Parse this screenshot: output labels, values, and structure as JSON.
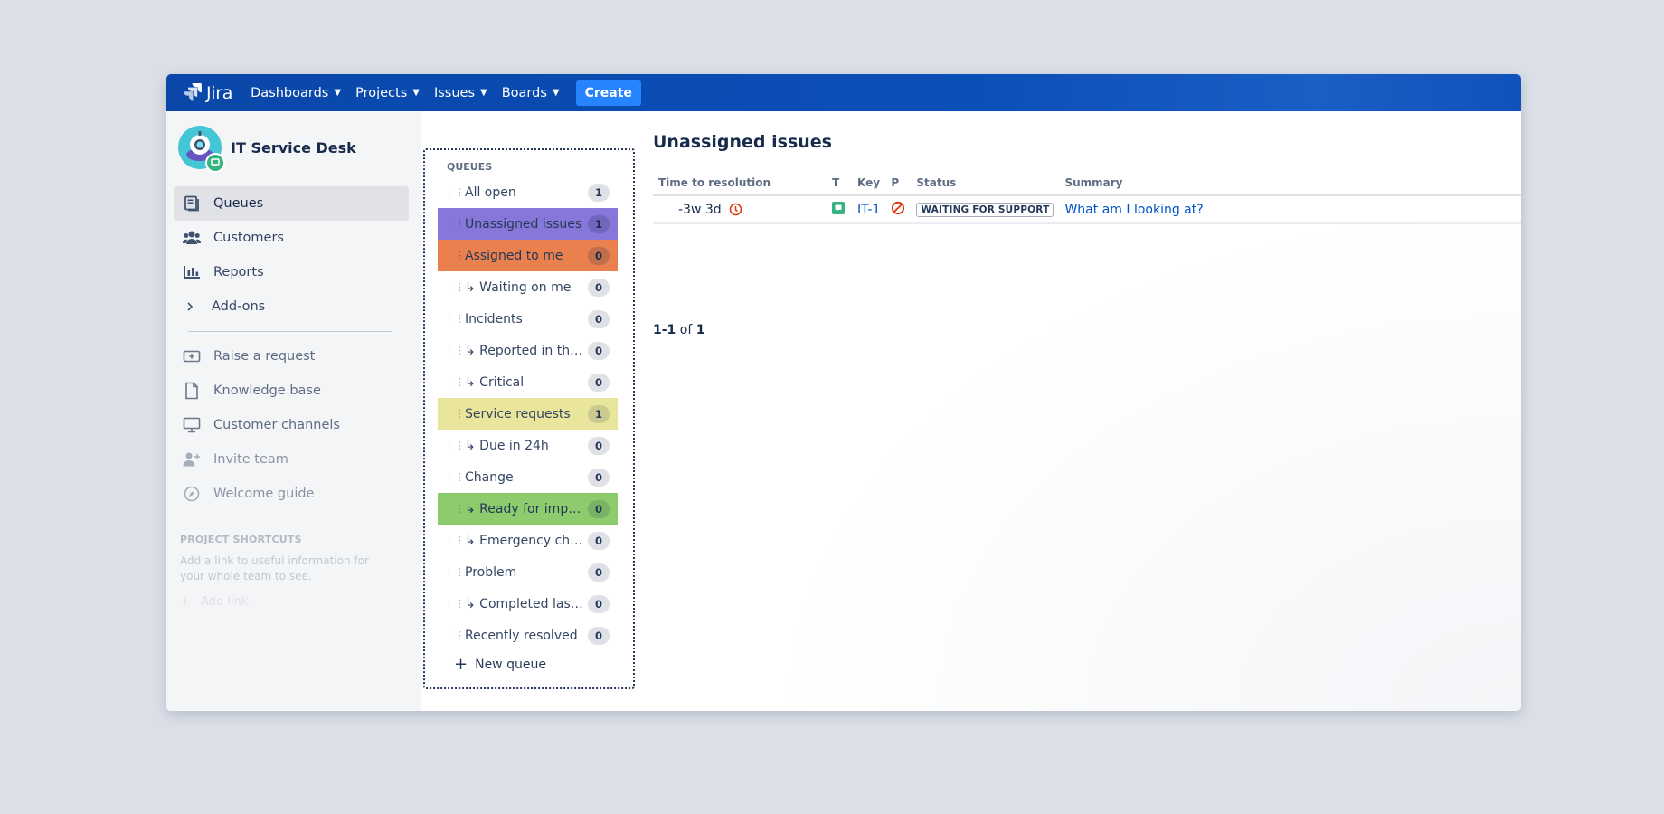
{
  "topnav": {
    "logo_text": "Jira",
    "items": [
      {
        "label": "Dashboards"
      },
      {
        "label": "Projects"
      },
      {
        "label": "Issues"
      },
      {
        "label": "Boards"
      }
    ],
    "create_label": "Create"
  },
  "project": {
    "name": "IT Service Desk"
  },
  "sidebar": {
    "items": [
      {
        "label": "Queues",
        "icon": "queues-icon"
      },
      {
        "label": "Customers",
        "icon": "customers-icon"
      },
      {
        "label": "Reports",
        "icon": "reports-icon"
      },
      {
        "label": "Add-ons",
        "icon": "chevron-right-icon"
      }
    ],
    "secondary": [
      {
        "label": "Raise a request",
        "icon": "raise-request-icon"
      },
      {
        "label": "Knowledge base",
        "icon": "knowledge-base-icon"
      },
      {
        "label": "Customer channels",
        "icon": "customer-channels-icon"
      },
      {
        "label": "Invite team",
        "icon": "invite-team-icon"
      },
      {
        "label": "Welcome guide",
        "icon": "compass-icon"
      }
    ],
    "shortcuts_title": "PROJECT SHORTCUTS",
    "shortcuts_desc": "Add a link to useful information for your whole team to see.",
    "add_link": "Add link"
  },
  "queues": {
    "title": "QUEUES",
    "items": [
      {
        "label": "All open",
        "count": "1",
        "color": ""
      },
      {
        "label": "Unassigned issues",
        "count": "1",
        "color": "#8777d9"
      },
      {
        "label": "Assigned to me",
        "count": "0",
        "color": "#e9804e"
      },
      {
        "label": "↳ Waiting on me",
        "count": "0",
        "color": ""
      },
      {
        "label": "Incidents",
        "count": "0",
        "color": ""
      },
      {
        "label": "↳ Reported in the last hour",
        "count": "0",
        "color": ""
      },
      {
        "label": "↳ Critical",
        "count": "0",
        "color": ""
      },
      {
        "label": "Service requests",
        "count": "1",
        "color": "#e9e59a"
      },
      {
        "label": "↳ Due in 24h",
        "count": "0",
        "color": ""
      },
      {
        "label": "Change",
        "count": "0",
        "color": ""
      },
      {
        "label": "↳ Ready for implementation",
        "count": "0",
        "color": "#8dcc6c"
      },
      {
        "label": "↳ Emergency change",
        "count": "0",
        "color": ""
      },
      {
        "label": "Problem",
        "count": "0",
        "color": ""
      },
      {
        "label": "↳ Completed last week",
        "count": "0",
        "color": ""
      },
      {
        "label": "Recently resolved",
        "count": "0",
        "color": ""
      }
    ],
    "new_queue_label": "New queue"
  },
  "main": {
    "title": "Unassigned issues",
    "columns": [
      "Time to resolution",
      "T",
      "Key",
      "P",
      "Status",
      "Summary"
    ],
    "rows": [
      {
        "time_to_resolution": "-3w 3d",
        "type_icon": "service-request-icon",
        "key": "IT-1",
        "priority_icon": "blocker-priority-icon",
        "status": "WAITING FOR SUPPORT",
        "summary": "What am I looking at?"
      }
    ],
    "pager": {
      "range": "1-1",
      "of": "of",
      "total": "1"
    }
  }
}
